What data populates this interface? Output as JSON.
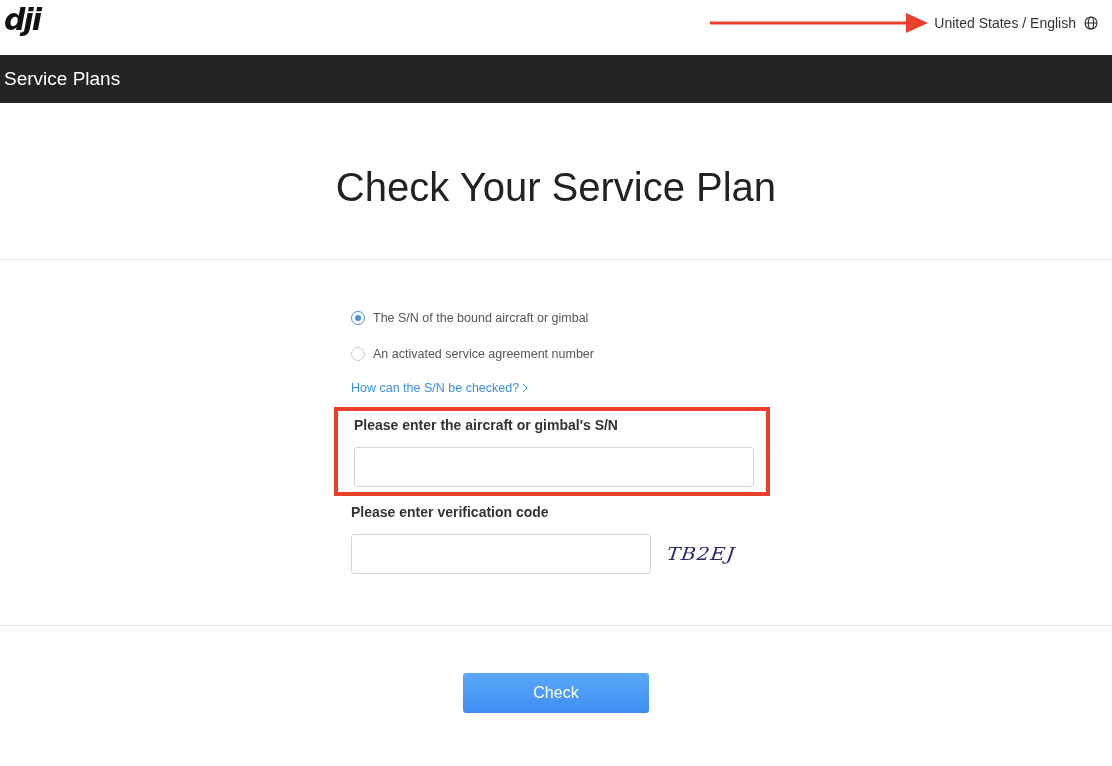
{
  "header": {
    "logo": "dji",
    "locale": "United States / English"
  },
  "nav_bar": {
    "title": "Service Plans"
  },
  "heading": "Check Your Service Plan",
  "options": [
    {
      "label": "The S/N of the bound aircraft or gimbal",
      "selected": true
    },
    {
      "label": "An activated service agreement number",
      "selected": false
    }
  ],
  "help_link": "How can the S/N be checked?",
  "sn_field": {
    "label": "Please enter the aircraft or gimbal's S/N",
    "highlighted": true
  },
  "code_field": {
    "label": "Please enter verification code",
    "captcha": "TB2EJ"
  },
  "submit_button": "Check",
  "annotation_arrow": true
}
